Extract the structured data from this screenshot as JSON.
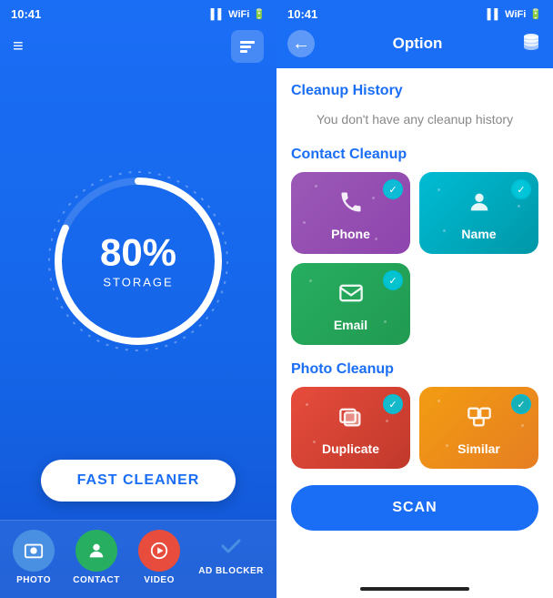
{
  "left": {
    "status_time": "10:41",
    "storage_percent": "80%",
    "storage_label": "STORAGE",
    "fast_cleaner_btn": "FAST CLEANER",
    "nav_items": [
      {
        "id": "photo",
        "label": "PHOTO",
        "icon": "🖼",
        "color": "blue"
      },
      {
        "id": "contact",
        "label": "CONTACT",
        "icon": "👤",
        "color": "green"
      },
      {
        "id": "video",
        "label": "VIDEO",
        "icon": "▶",
        "color": "red"
      },
      {
        "id": "adblocker",
        "label": "AD BLOCKER",
        "icon": "✔",
        "color": "check"
      }
    ]
  },
  "right": {
    "status_time": "10:41",
    "title": "Option",
    "back_label": "←",
    "sections": [
      {
        "id": "cleanup-history",
        "title": "Cleanup History",
        "empty_text": "You don't have any cleanup history"
      },
      {
        "id": "contact-cleanup",
        "title": "Contact Cleanup",
        "cards": [
          {
            "id": "phone",
            "label": "Phone",
            "color": "purple",
            "icon": "📞"
          },
          {
            "id": "name",
            "label": "Name",
            "color": "teal",
            "icon": "👤"
          },
          {
            "id": "email",
            "label": "Email",
            "color": "green",
            "icon": "✉"
          }
        ]
      },
      {
        "id": "photo-cleanup",
        "title": "Photo Cleanup",
        "cards": [
          {
            "id": "duplicate",
            "label": "Duplicate",
            "color": "orange",
            "icon": "🖼"
          },
          {
            "id": "similar",
            "label": "Similar",
            "color": "amber",
            "icon": "🖼"
          }
        ]
      }
    ],
    "scan_btn": "SCAN"
  }
}
